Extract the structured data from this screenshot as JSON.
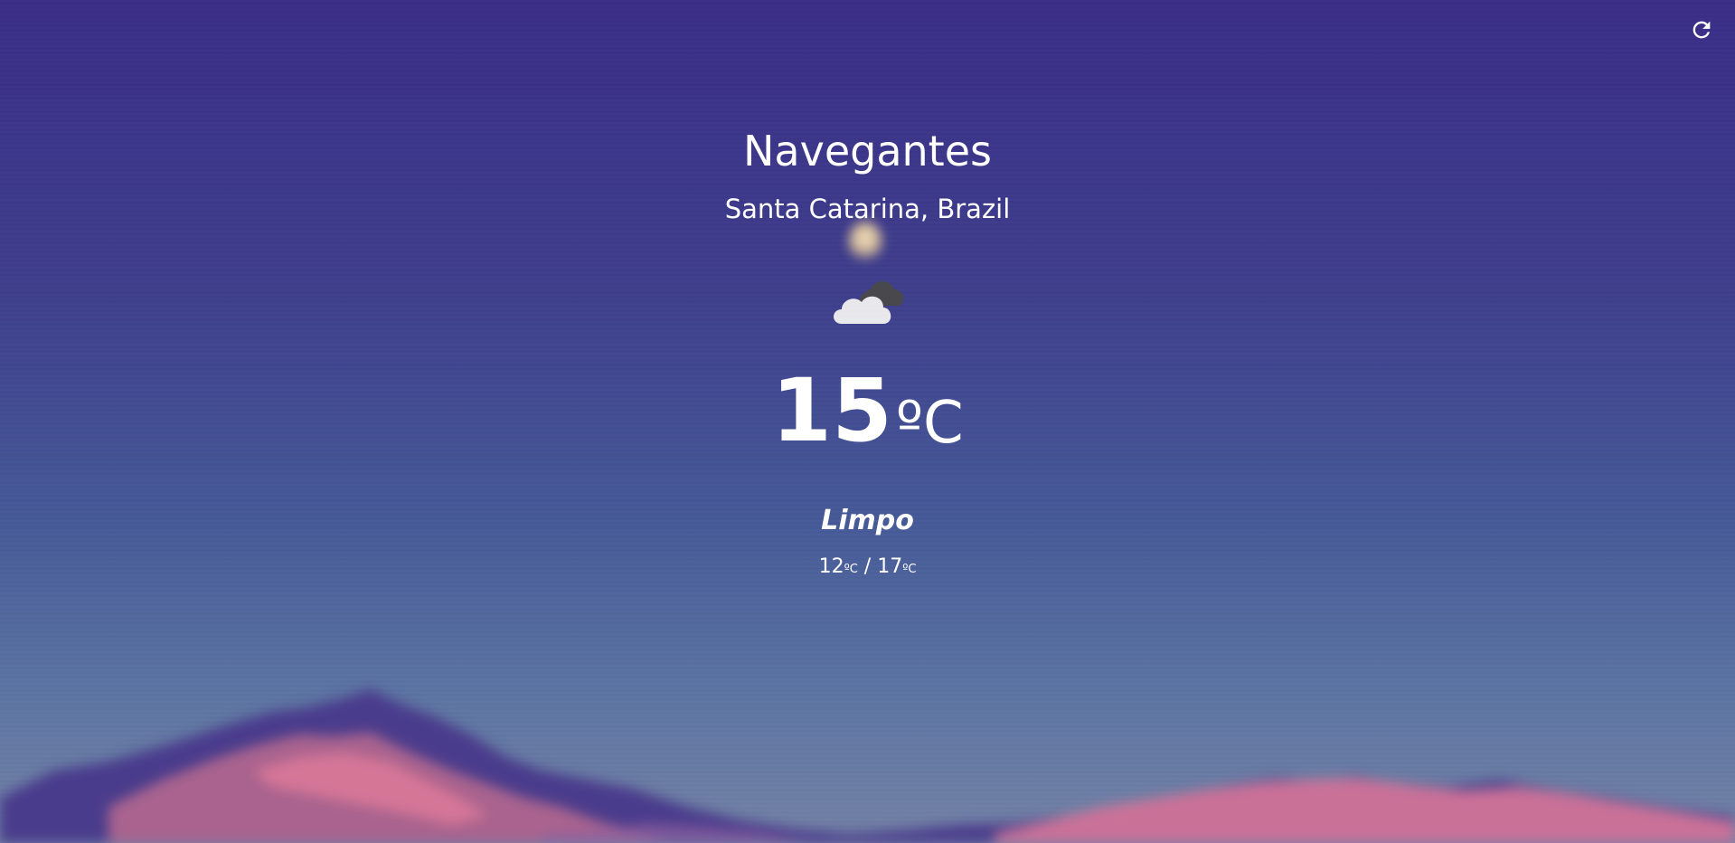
{
  "location": {
    "city": "Navegantes",
    "region": "Santa Catarina, Brazil"
  },
  "weather": {
    "icon": "cloudy-icon",
    "temperature": "15",
    "unit": "ºC",
    "condition": "Limpo",
    "min": "12",
    "max": "17",
    "min_unit": "ºC",
    "max_unit": "ºC",
    "separator": " / "
  },
  "controls": {
    "refresh_icon": "refresh-icon"
  },
  "colors": {
    "sky_top": "#3a2e88",
    "sky_bottom": "#7482a6",
    "mountain_pink": "#e07a9a",
    "mountain_purple": "#4a3c8c",
    "text": "#ffffff"
  }
}
